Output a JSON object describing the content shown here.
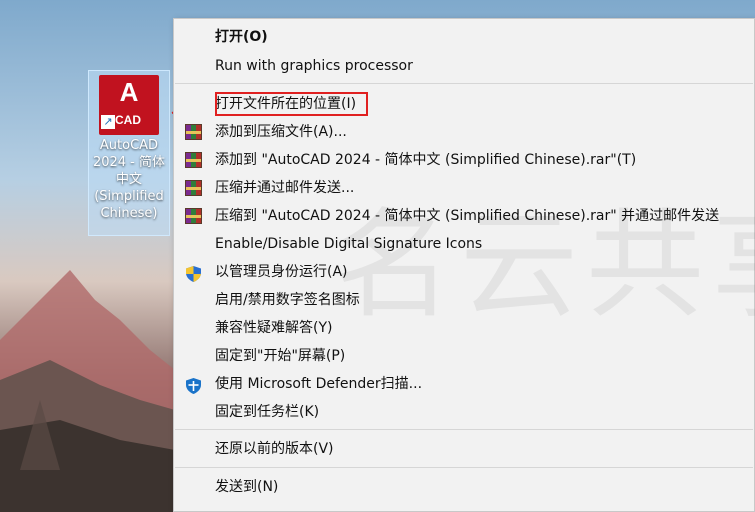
{
  "desktop": {
    "icon_tile_letter": "A",
    "icon_tile_sub": "CAD",
    "icon_label": "AutoCAD 2024 - 简体中文 (Simplified Chinese)"
  },
  "menu": {
    "items": [
      {
        "label": "打开(O)",
        "icon": "",
        "bold": true
      },
      {
        "label": "Run with graphics processor",
        "icon": ""
      },
      {
        "label": "打开文件所在的位置(I)",
        "icon": ""
      },
      {
        "label": "添加到压缩文件(A)...",
        "icon": "rar-archive-icon"
      },
      {
        "label": "添加到 \"AutoCAD 2024 - 简体中文 (Simplified Chinese).rar\"(T)",
        "icon": "rar-archive-icon"
      },
      {
        "label": "压缩并通过邮件发送...",
        "icon": "rar-archive-icon"
      },
      {
        "label": "压缩到 \"AutoCAD 2024 - 简体中文 (Simplified Chinese).rar\" 并通过邮件发送",
        "icon": "rar-archive-icon"
      },
      {
        "label": "Enable/Disable Digital Signature Icons",
        "icon": ""
      },
      {
        "label": "以管理员身份运行(A)",
        "icon": "uac-shield-icon"
      },
      {
        "label": "启用/禁用数字签名图标",
        "icon": ""
      },
      {
        "label": "兼容性疑难解答(Y)",
        "icon": ""
      },
      {
        "label": "固定到\"开始\"屏幕(P)",
        "icon": ""
      },
      {
        "label": "使用 Microsoft Defender扫描...",
        "icon": "defender-icon"
      },
      {
        "label": "固定到任务栏(K)",
        "icon": ""
      },
      {
        "label": "还原以前的版本(V)",
        "icon": ""
      },
      {
        "label": "发送到(N)",
        "icon": ""
      }
    ]
  },
  "watermark": "名云共享",
  "colors": {
    "highlight_border": "#e02020",
    "autocad_red": "#c1121f",
    "menu_bg": "#f2f2f2"
  }
}
